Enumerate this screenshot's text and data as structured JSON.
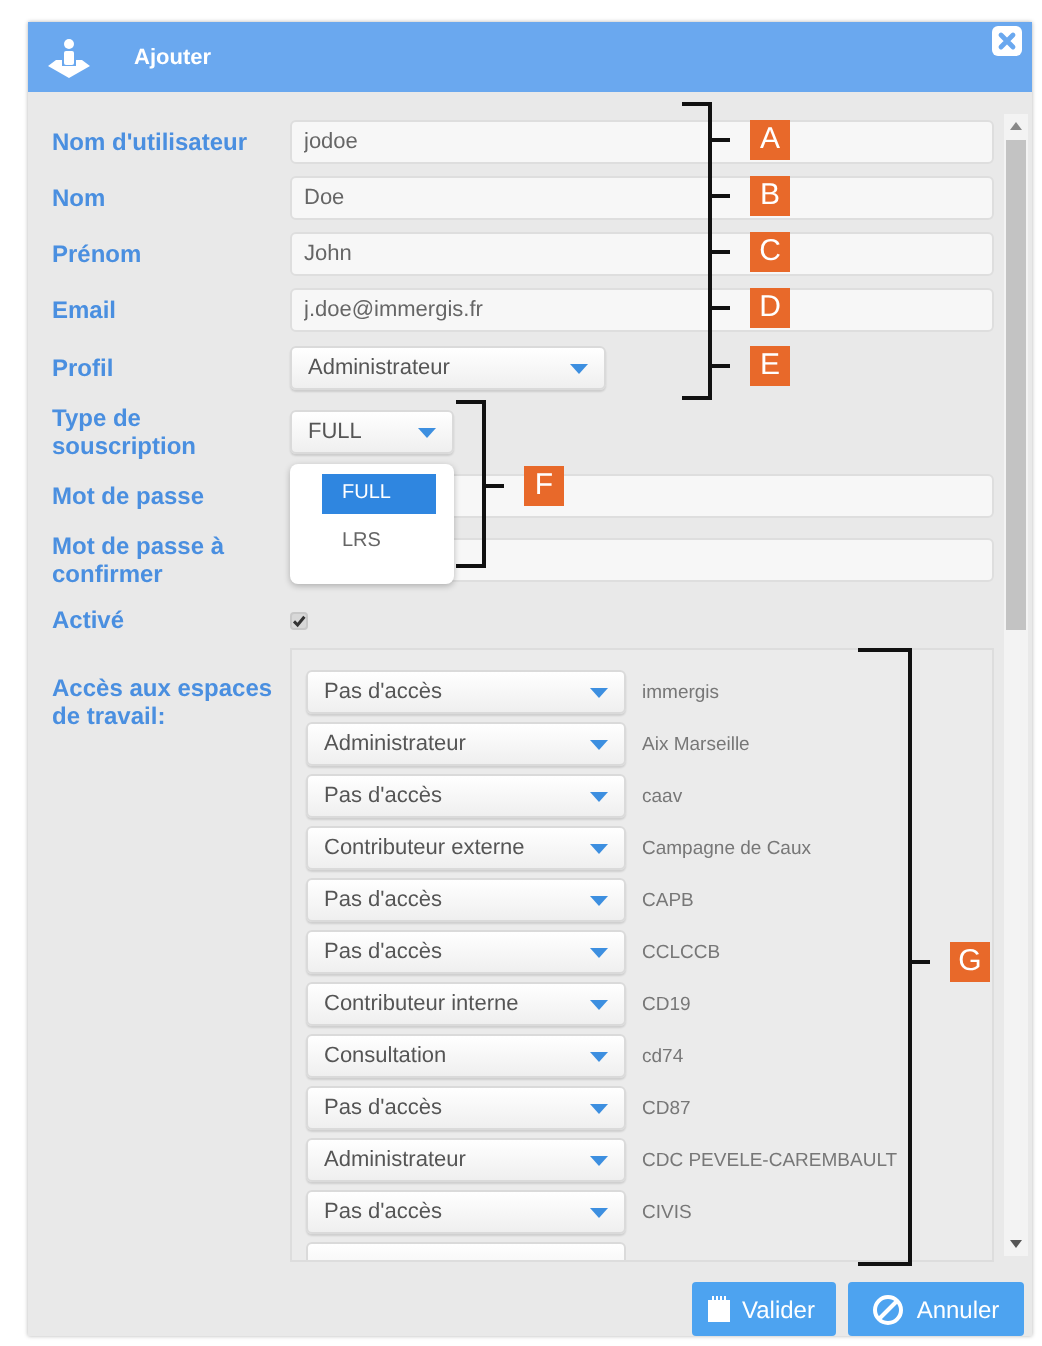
{
  "dialog": {
    "title": "Ajouter",
    "fields": [
      {
        "kind": "text",
        "label": "Nom d'utilisateur",
        "value": "jodoe"
      },
      {
        "kind": "text",
        "label": "Nom",
        "value": "Doe"
      },
      {
        "kind": "text",
        "label": "Prénom",
        "value": "John"
      },
      {
        "kind": "text",
        "label": "Email",
        "value": "j.doe@immergis.fr"
      },
      {
        "kind": "select",
        "label": "Profil",
        "value": "Administrateur"
      },
      {
        "kind": "select",
        "label": "Type de souscription",
        "value": "FULL",
        "expanded": true,
        "options": [
          {
            "label": "FULL",
            "selected": true
          },
          {
            "label": "LRS",
            "selected": false
          }
        ]
      },
      {
        "kind": "password",
        "label": "Mot de passe"
      },
      {
        "kind": "password",
        "label": "Mot de passe à confirmer"
      },
      {
        "kind": "checkbox",
        "label": "Activé",
        "checked": true
      }
    ],
    "workspaces": {
      "label": "Accès aux espaces de travail:",
      "rows": [
        {
          "access": "Pas d'accès",
          "name": "immergis"
        },
        {
          "access": "Administrateur",
          "name": "Aix Marseille"
        },
        {
          "access": "Pas d'accès",
          "name": "caav"
        },
        {
          "access": "Contributeur externe",
          "name": "Campagne de Caux"
        },
        {
          "access": "Pas d'accès",
          "name": "CAPB"
        },
        {
          "access": "Pas d'accès",
          "name": "CCLCCB"
        },
        {
          "access": "Contributeur interne",
          "name": "CD19"
        },
        {
          "access": "Consultation",
          "name": "cd74"
        },
        {
          "access": "Pas d'accès",
          "name": "CD87"
        },
        {
          "access": "Administrateur",
          "name": "CDC PEVELE-CAREMBAULT"
        },
        {
          "access": "Pas d'accès",
          "name": "CIVIS"
        }
      ]
    },
    "buttons": [
      {
        "kind": "save",
        "label": "Valider"
      },
      {
        "kind": "cancel",
        "label": "Annuler"
      }
    ]
  },
  "annotations": [
    {
      "letters": [
        "A",
        "B",
        "C",
        "D",
        "E"
      ]
    },
    {
      "letters": [
        "F"
      ]
    },
    {
      "letters": [
        "G"
      ]
    }
  ]
}
